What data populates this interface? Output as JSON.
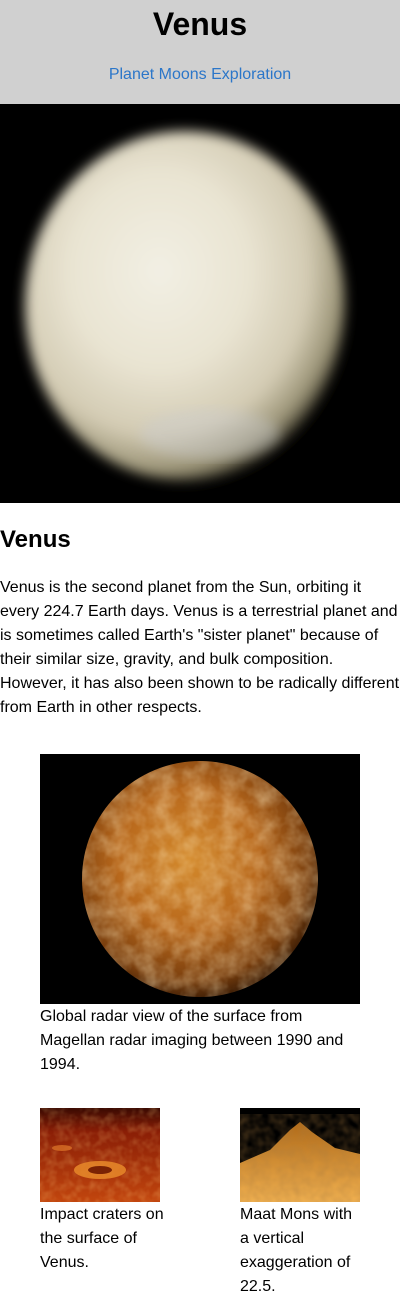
{
  "header": {
    "title": "Venus",
    "nav": [
      "Planet",
      "Moons",
      "Exploration"
    ]
  },
  "hero": {
    "image": "venus-globe-image"
  },
  "article": {
    "heading": "Venus",
    "body": "Venus is the second planet from the Sun, orbiting it every 224.7 Earth days. Venus is a terrestrial planet and is sometimes called Earth's \"sister planet\" because of their similar size, gravity, and bulk composition. However, it has also been shown to be radically different from Earth in other respects."
  },
  "figures": [
    {
      "image": "venus-radar-globe-image",
      "caption": "Global radar view of the surface from Magellan radar imaging between 1990 and 1994."
    },
    {
      "image": "impact-craters-image",
      "caption": "Impact craters on the surface of Venus."
    },
    {
      "image": "maat-mons-image",
      "caption": "Maat Mons with a vertical exaggeration of 22.5."
    }
  ],
  "colors": {
    "header_bg": "#d0d0d0",
    "link": "#2b76c9",
    "hero_bg": "#000000"
  }
}
